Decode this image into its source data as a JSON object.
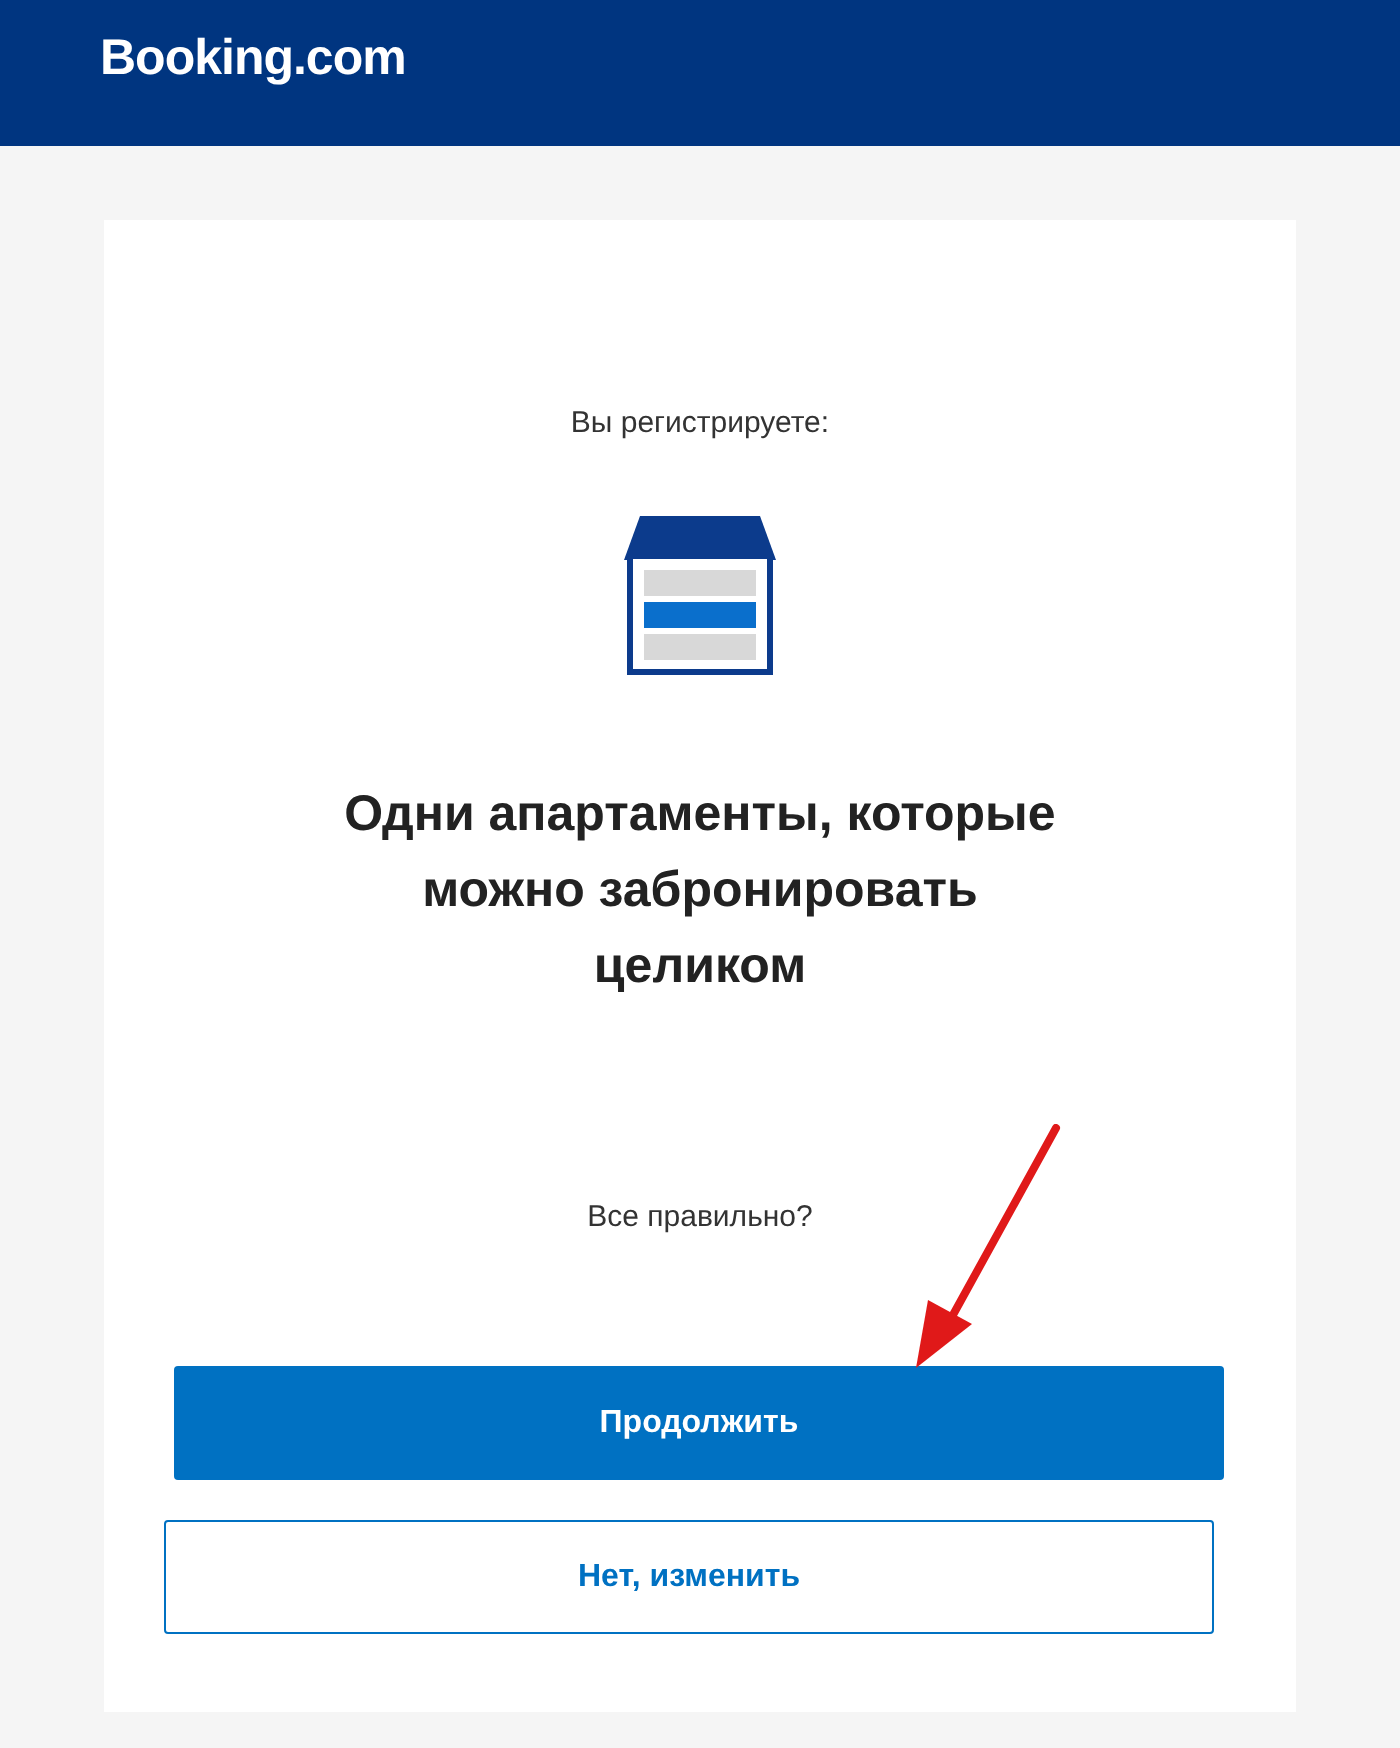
{
  "header": {
    "logo": "Booking.com"
  },
  "card": {
    "intro": "Вы регистрируете:",
    "title": "Одни апартаменты, которые можно забронировать целиком",
    "question": "Все правильно?"
  },
  "buttons": [
    {
      "kind": "primary",
      "label": "Продолжить"
    },
    {
      "kind": "secondary",
      "label": "Нет, изменить"
    }
  ]
}
